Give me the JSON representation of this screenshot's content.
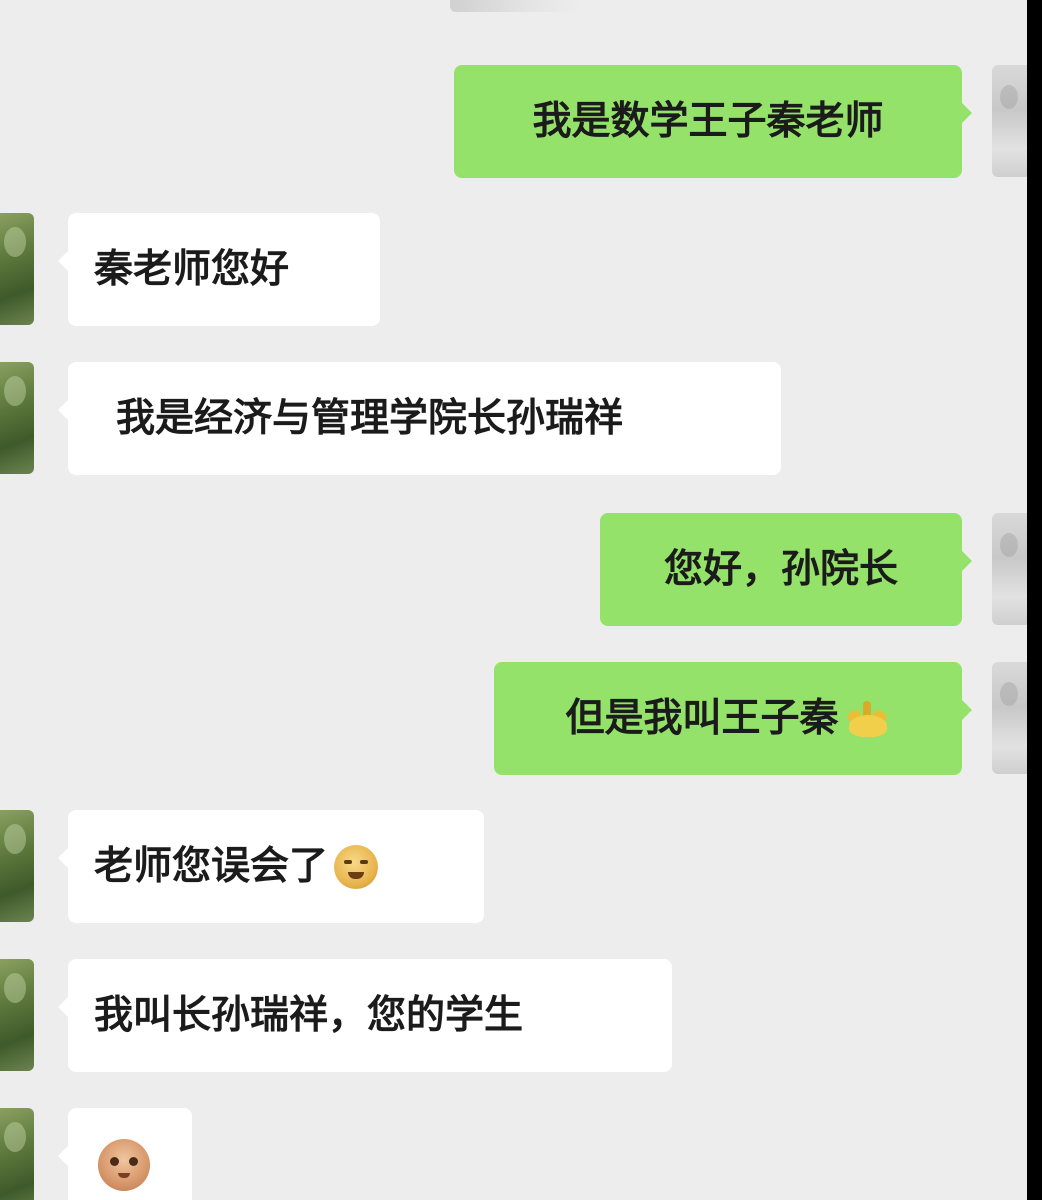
{
  "messages": [
    {
      "side": "right",
      "text": "我是数学王子秦老师"
    },
    {
      "side": "left",
      "text": "秦老师您好"
    },
    {
      "side": "left",
      "text": "我是经济与管理学院长孙瑞祥"
    },
    {
      "side": "right",
      "text": "您好，孙院长"
    },
    {
      "side": "right",
      "text": "但是我叫王子秦",
      "emoji": "banana-emoji"
    },
    {
      "side": "left",
      "text": "老师您误会了",
      "emoji": "grimace-emoji"
    },
    {
      "side": "left",
      "text": "我叫长孙瑞祥，您的学生"
    },
    {
      "side": "left",
      "sticker": "face-sticker"
    }
  ],
  "colors": {
    "background": "#ededed",
    "sent_bubble": "#95e26a",
    "received_bubble": "#ffffff",
    "text": "#1b1b1b"
  }
}
